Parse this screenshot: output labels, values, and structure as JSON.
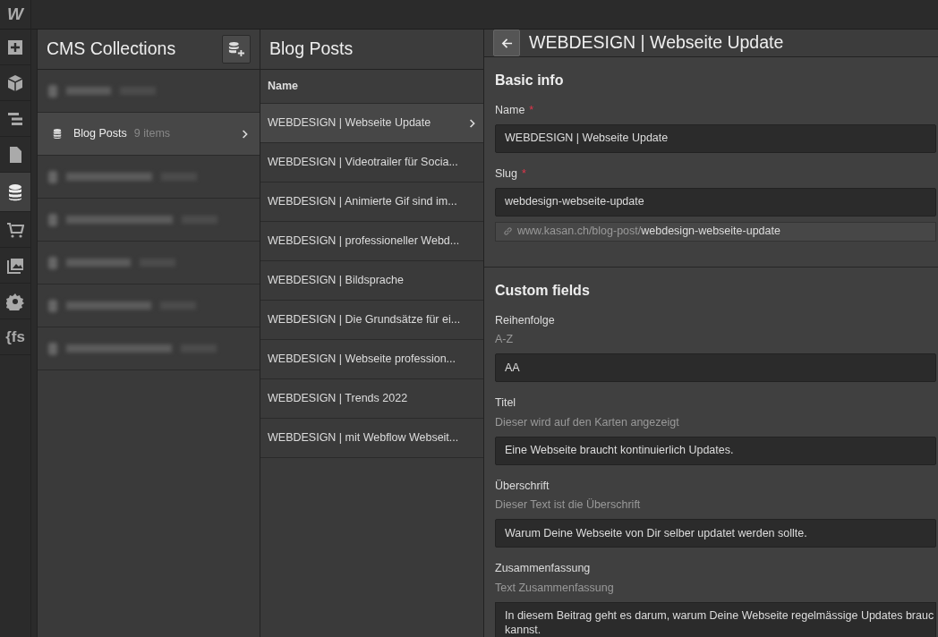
{
  "logo": "W",
  "tool_bar": [
    {
      "selected": false
    },
    {
      "selected": false
    },
    {
      "selected": false
    },
    {
      "selected": false
    },
    {
      "selected": true
    },
    {
      "selected": false
    },
    {
      "selected": false
    },
    {
      "selected": false
    },
    {
      "label": "{fs",
      "selected": false
    }
  ],
  "collections": {
    "title": "CMS Collections",
    "items": [
      {
        "kind": "blurred",
        "selected": false
      },
      {
        "kind": "item",
        "name": "Blog Posts",
        "count": "9 items",
        "selected": true
      },
      {
        "kind": "blurred",
        "selected": false
      },
      {
        "kind": "blurred",
        "selected": false
      },
      {
        "kind": "blurred",
        "selected": false
      },
      {
        "kind": "blurred",
        "selected": false
      },
      {
        "kind": "blurred",
        "selected": false
      }
    ]
  },
  "posts": {
    "title": "Blog Posts",
    "column": "Name",
    "rows": [
      {
        "name": "WEBDESIGN | Webseite Update",
        "selected": true
      },
      {
        "name": "WEBDESIGN | Videotrailer für Socia...",
        "selected": false
      },
      {
        "name": "WEBDESIGN | Animierte Gif sind im...",
        "selected": false
      },
      {
        "name": "WEBDESIGN | professioneller Webd...",
        "selected": false
      },
      {
        "name": "WEBDESIGN | Bildsprache",
        "selected": false
      },
      {
        "name": "WEBDESIGN | Die Grundsätze für ei...",
        "selected": false
      },
      {
        "name": "WEBDESIGN | Webseite profession...",
        "selected": false
      },
      {
        "name": "WEBDESIGN | Trends 2022",
        "selected": false
      },
      {
        "name": "WEBDESIGN | mit Webflow Webseit...",
        "selected": false
      }
    ]
  },
  "detail": {
    "title": "WEBDESIGN | Webseite Update",
    "basic_info": {
      "heading": "Basic info",
      "fields": [
        {
          "label": "Name",
          "required_mark": "*",
          "value": "WEBDESIGN | Webseite Update"
        },
        {
          "label": "Slug",
          "required_mark": "*",
          "value": "webdesign-webseite-update",
          "url_prefix": "www.kasan.ch/blog-post/",
          "url_slug": "webdesign-webseite-update"
        }
      ]
    },
    "custom_fields": {
      "heading": "Custom fields",
      "fields": [
        {
          "label": "Reihenfolge",
          "help": "A-Z",
          "value": "AA"
        },
        {
          "label": "Titel",
          "help": "Dieser wird auf den Karten angezeigt",
          "value": "Eine Webseite braucht kontinuierlich Updates."
        },
        {
          "label": "Überschrift",
          "help": "Dieser Text ist die Überschrift",
          "value": "Warum Deine Webseite von Dir selber updatet werden sollte."
        },
        {
          "label": "Zusammenfassung",
          "help": "Text Zusammenfassung",
          "lines": [
            "In diesem Beitrag geht es darum, warum Deine Webseite regelmässige Updates brauc",
            "kannst."
          ]
        }
      ]
    }
  }
}
